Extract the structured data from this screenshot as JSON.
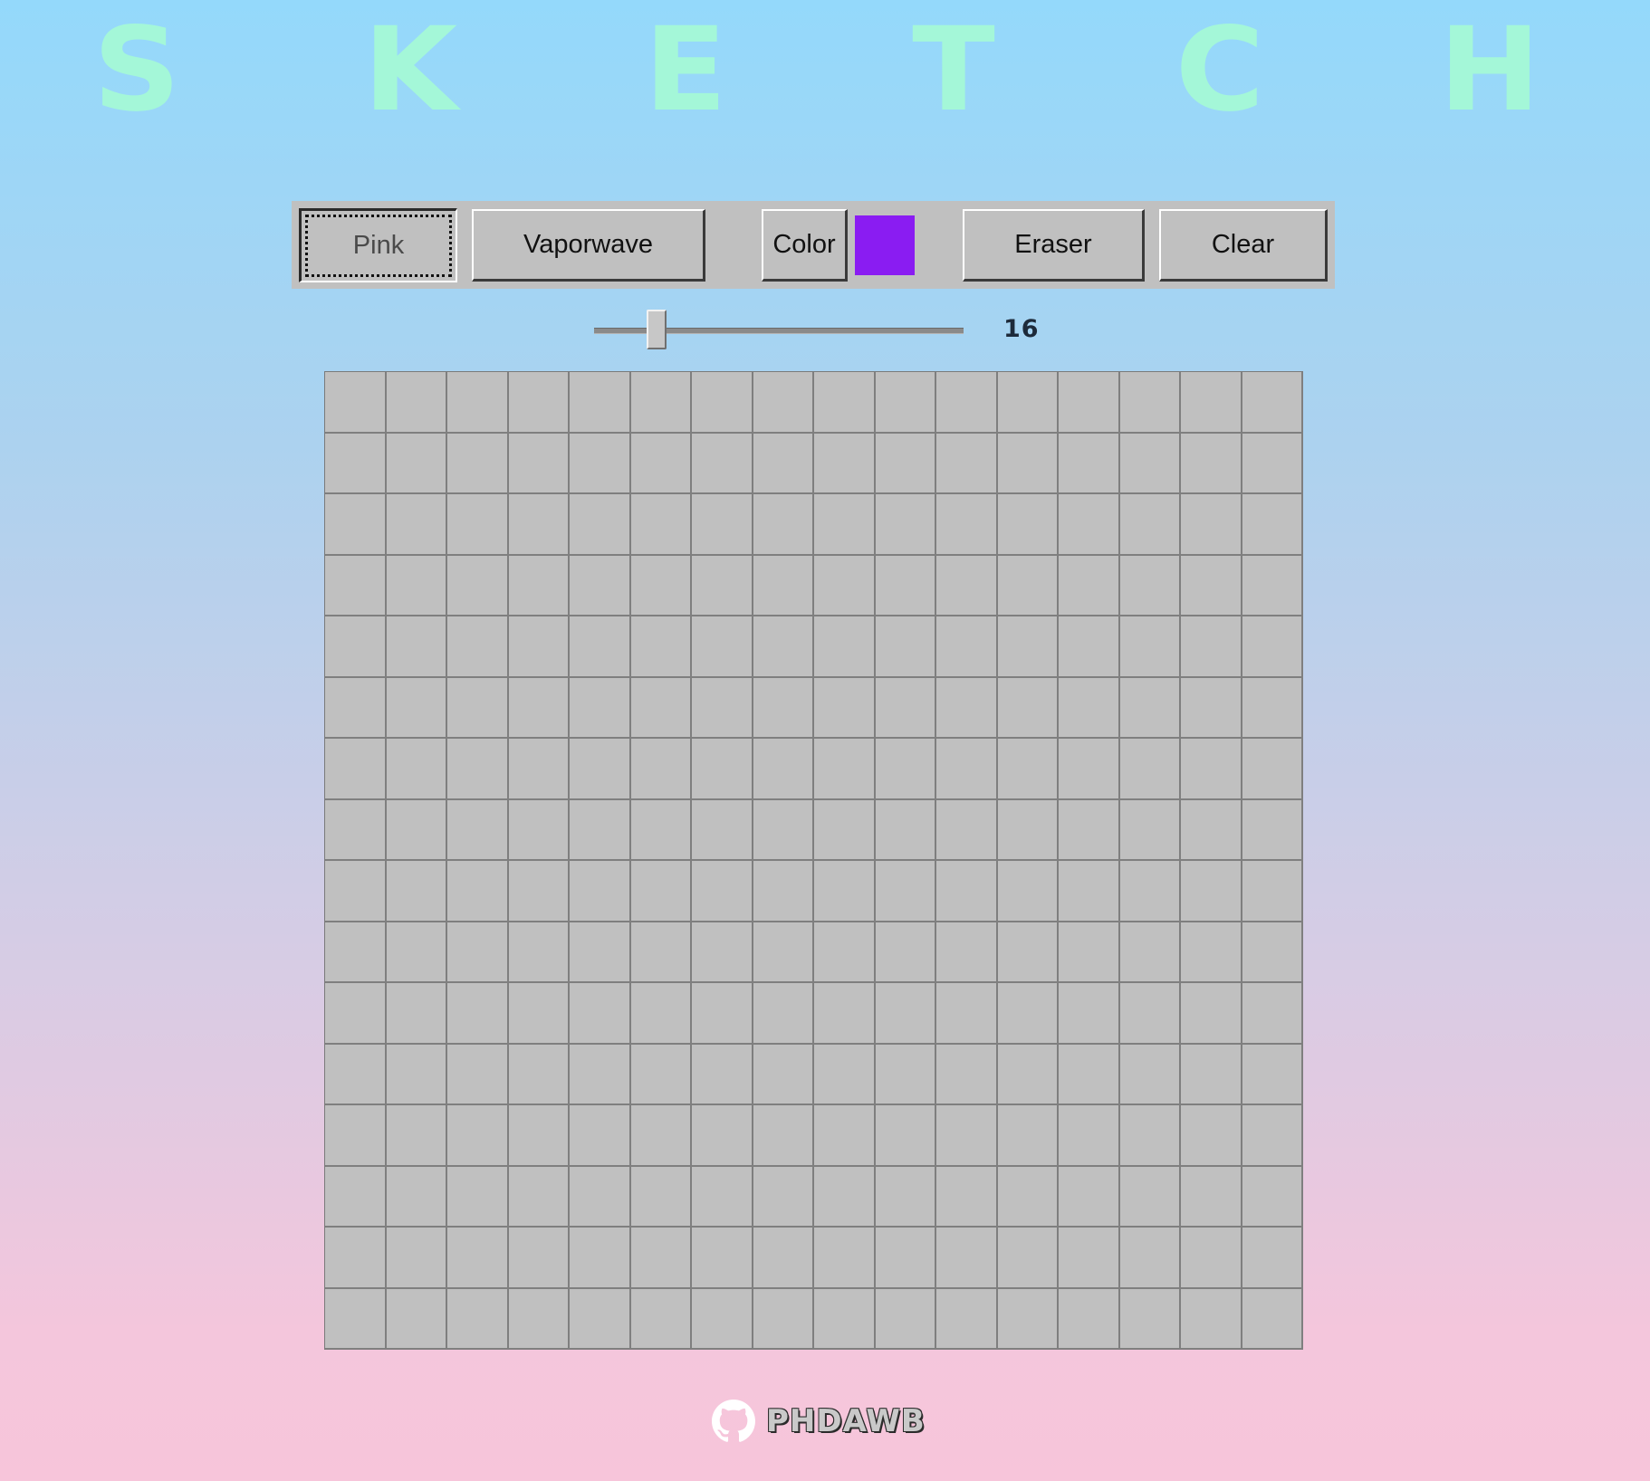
{
  "title": {
    "letters": [
      "S",
      "K",
      "E",
      "T",
      "C",
      "H"
    ]
  },
  "toolbar": {
    "pink_label": "Pink",
    "vaporwave_label": "Vaporwave",
    "color_label": "Color",
    "color_value": "#8a1cf2",
    "eraser_label": "Eraser",
    "clear_label": "Clear",
    "active_mode": "Pink"
  },
  "slider": {
    "value": "16",
    "min": 1,
    "max": 100
  },
  "grid": {
    "rows": 16,
    "cols": 16,
    "cell_color": "#c0c0c0",
    "line_color": "#7f7f7f"
  },
  "footer": {
    "icon": "github-icon",
    "label": "PHDAWB"
  },
  "colors": {
    "title": "#a4f7d8",
    "background_top": "#94d9fb",
    "background_bottom": "#f7c5da",
    "toolbar": "#c0c0c0"
  }
}
